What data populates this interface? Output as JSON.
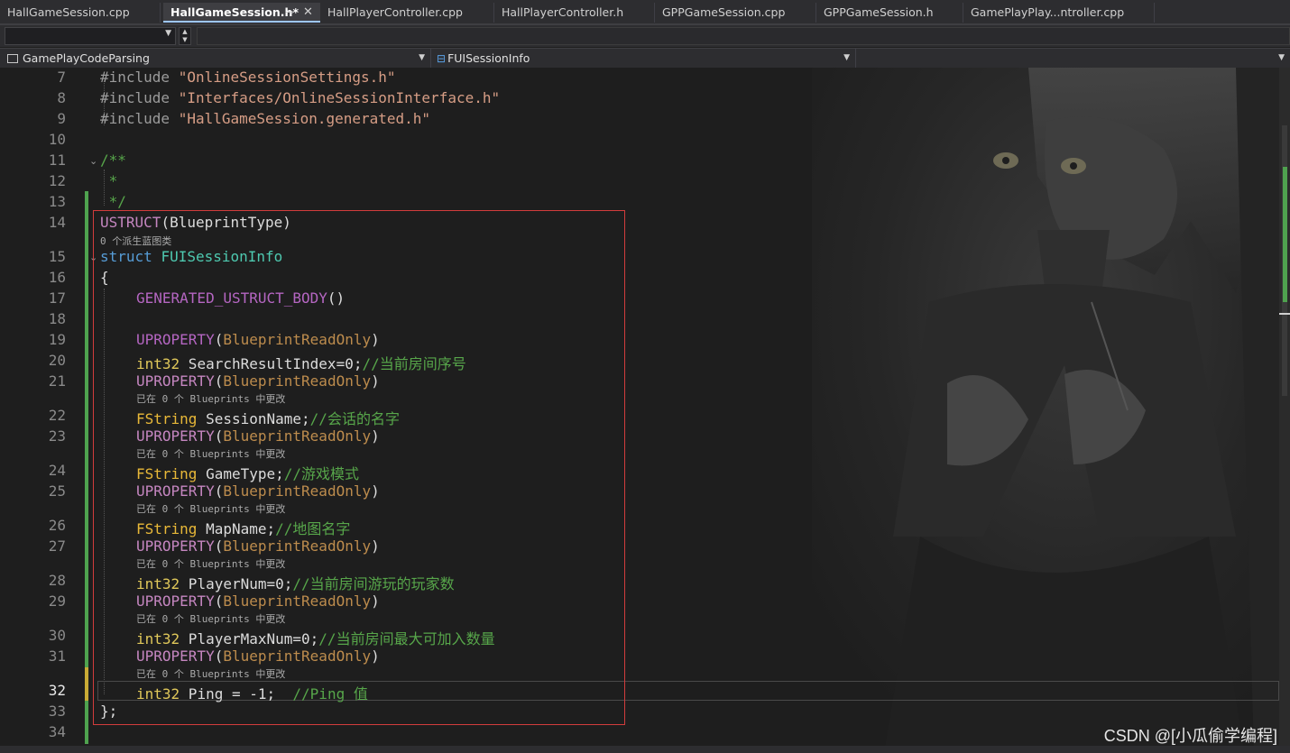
{
  "tabs": [
    {
      "label": "HallGameSession.cpp",
      "active": false
    },
    {
      "label": "HallGameSession.h*",
      "active": true
    },
    {
      "label": "HallPlayerController.cpp",
      "active": false
    },
    {
      "label": "HallPlayerController.h",
      "active": false
    },
    {
      "label": "GPPGameSession.cpp",
      "active": false
    },
    {
      "label": "GPPGameSession.h",
      "active": false
    },
    {
      "label": "GamePlayPlay...ntroller.cpp",
      "active": false
    }
  ],
  "tab_pin_glyph": "⊸",
  "tab_close_glyph": "✕",
  "nav": {
    "project": "GamePlayCodeParsing",
    "scope": "FUISessionInfo"
  },
  "code": {
    "line7": {
      "num": "7",
      "kw": "#include",
      "str": "\"OnlineSessionSettings.h\""
    },
    "line8": {
      "num": "8",
      "kw": "#include",
      "str": "\"Interfaces/OnlineSessionInterface.h\""
    },
    "line9": {
      "num": "9",
      "kw": "#include",
      "str": "\"HallGameSession.generated.h\""
    },
    "line10": {
      "num": "10"
    },
    "line11": {
      "num": "11",
      "text": "/**"
    },
    "line12": {
      "num": "12",
      "text": " *"
    },
    "line13": {
      "num": "13",
      "text": " */"
    },
    "line14": {
      "num": "14",
      "macro": "USTRUCT",
      "arg": "(BlueprintType)"
    },
    "lens14": "0 个派生蓝图类",
    "line15": {
      "num": "15",
      "kw": "struct",
      "name": "FUISessionInfo"
    },
    "line16": {
      "num": "16",
      "text": "{"
    },
    "line17": {
      "num": "17",
      "macro": "GENERATED_USTRUCT_BODY",
      "arg": "()"
    },
    "line18": {
      "num": "18"
    },
    "line19": {
      "num": "19",
      "macro": "UPROPERTY",
      "arg": "BlueprintReadOnly"
    },
    "line20": {
      "num": "20",
      "type": "int32",
      "decl": " SearchResultIndex=0;",
      "cmt": "//当前房间序号"
    },
    "line21": {
      "num": "21",
      "macro": "UPROPERTY",
      "arg": "BlueprintReadOnly"
    },
    "lens21": "已在 0 个 Blueprints 中更改",
    "line22": {
      "num": "22",
      "type": "FString",
      "decl": " SessionName;",
      "cmt": "//会话的名字"
    },
    "line23": {
      "num": "23",
      "macro": "UPROPERTY",
      "arg": "BlueprintReadOnly"
    },
    "lens23": "已在 0 个 Blueprints 中更改",
    "line24": {
      "num": "24",
      "type": "FString",
      "decl": " GameType;",
      "cmt": "//游戏模式"
    },
    "line25": {
      "num": "25",
      "macro": "UPROPERTY",
      "arg": "BlueprintReadOnly"
    },
    "lens25": "已在 0 个 Blueprints 中更改",
    "line26": {
      "num": "26",
      "type": "FString",
      "decl": " MapName;",
      "cmt": "//地图名字"
    },
    "line27": {
      "num": "27",
      "macro": "UPROPERTY",
      "arg": "BlueprintReadOnly"
    },
    "lens27": "已在 0 个 Blueprints 中更改",
    "line28": {
      "num": "28",
      "type": "int32",
      "decl": " PlayerNum=0;",
      "cmt": "//当前房间游玩的玩家数"
    },
    "line29": {
      "num": "29",
      "macro": "UPROPERTY",
      "arg": "BlueprintReadOnly"
    },
    "lens29": "已在 0 个 Blueprints 中更改",
    "line30": {
      "num": "30",
      "type": "int32",
      "decl": " PlayerMaxNum=0;",
      "cmt": "//当前房间最大可加入数量"
    },
    "line31": {
      "num": "31",
      "macro": "UPROPERTY",
      "arg": "BlueprintReadOnly"
    },
    "lens31": "已在 0 个 Blueprints 中更改",
    "line32": {
      "num": "32",
      "type": "int32",
      "decl": " Ping = -1;  ",
      "cmt": "//Ping 值"
    },
    "line33": {
      "num": "33",
      "text": "};"
    },
    "line34": {
      "num": "34"
    }
  },
  "watermark": "CSDN @[小瓜偷学编程]"
}
